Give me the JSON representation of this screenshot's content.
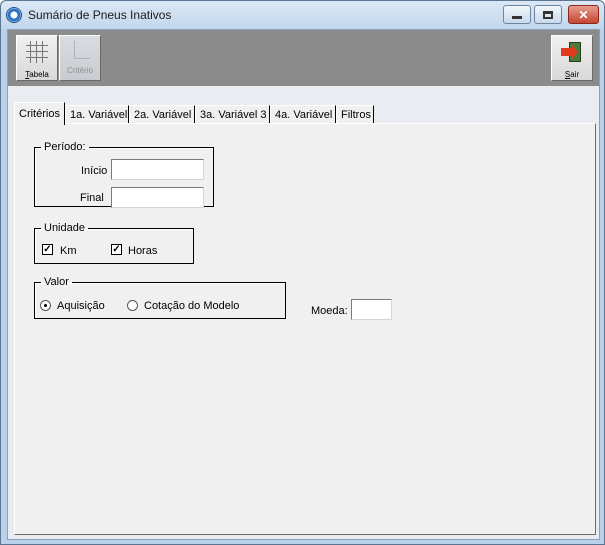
{
  "window": {
    "title": "Sumário de Pneus Inativos",
    "controls": {
      "minimize_icon": "minimize-icon",
      "maximize_icon": "maximize-icon",
      "close_label": "✕"
    }
  },
  "toolbar": {
    "tabela": {
      "label_prefix": "T",
      "label_rest": "abela",
      "icon": "table-grid-icon"
    },
    "criterio": {
      "label": "Critério",
      "icon": "criteria-icon",
      "enabled": false
    },
    "sair": {
      "label_prefix": "S",
      "label_rest": "air",
      "icon": "exit-door-icon"
    }
  },
  "tabs": [
    {
      "label": "Critérios",
      "active": true
    },
    {
      "label": "1a. Variável",
      "active": false
    },
    {
      "label": "2a. Variável",
      "active": false
    },
    {
      "label": "3a. Variável 3",
      "active": false
    },
    {
      "label": "4a. Variável",
      "active": false
    },
    {
      "label": "Filtros",
      "active": false
    }
  ],
  "periodo": {
    "legend": "Período:",
    "inicio_label": "Início",
    "inicio_value": "",
    "final_label": "Final",
    "final_value": ""
  },
  "unidade": {
    "legend": "Unidade",
    "km_label": "Km",
    "km_checked": true,
    "horas_label": "Horas",
    "horas_checked": true
  },
  "valor": {
    "legend": "Valor",
    "options": [
      {
        "label": "Aquisição",
        "selected": true
      },
      {
        "label": "Cotação do Modelo",
        "selected": false
      }
    ]
  },
  "moeda": {
    "label": "Moeda:",
    "value": ""
  }
}
